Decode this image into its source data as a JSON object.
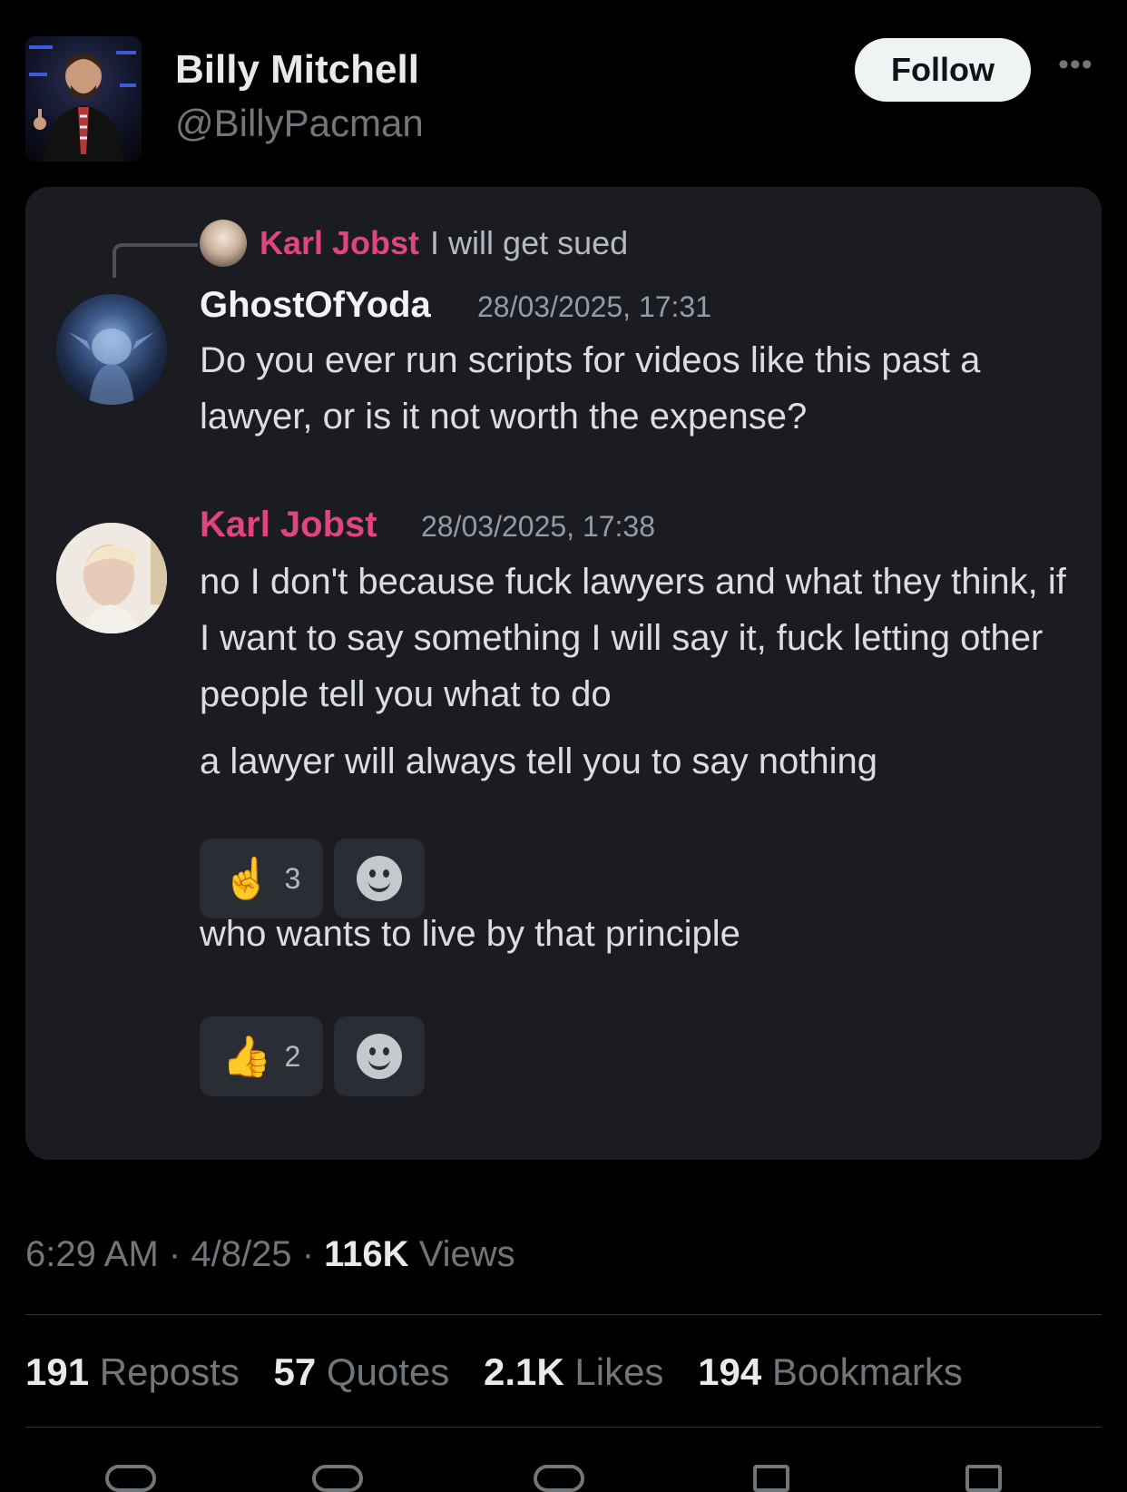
{
  "tweet": {
    "author_name": "Billy Mitchell",
    "handle": "@BillyPacman",
    "follow_label": "Follow",
    "more_icon": "•••",
    "time": "6:29 AM",
    "date": "4/8/25",
    "views_count": "116K",
    "views_label": "Views",
    "separator": "·"
  },
  "stats": [
    {
      "count": "191",
      "label": "Reposts"
    },
    {
      "count": "57",
      "label": "Quotes"
    },
    {
      "count": "2.1K",
      "label": "Likes"
    },
    {
      "count": "194",
      "label": "Bookmarks"
    }
  ],
  "screenshot": {
    "reply_ref": {
      "author": "Karl Jobst",
      "text": "I will get sued"
    },
    "message1": {
      "author": "GhostOfYoda",
      "timestamp": "28/03/2025, 17:31",
      "text": "Do you ever run scripts for videos like this past a lawyer, or is it not worth the expense?"
    },
    "message2": {
      "author": "Karl Jobst",
      "timestamp": "28/03/2025, 17:38",
      "text1": "no I don't because fuck lawyers and what they think, if I want to say something I will say it, fuck letting other people tell you what to do",
      "text2": "a lawyer will always tell you to say nothing",
      "reaction1": {
        "emoji": "☝",
        "count": "3"
      },
      "text3": "who wants to live by that principle",
      "reaction2": {
        "emoji": "👍",
        "count": "2"
      }
    },
    "colors": {
      "discord_bg": "#1b1c22",
      "accent_name": "#e0457b"
    }
  }
}
